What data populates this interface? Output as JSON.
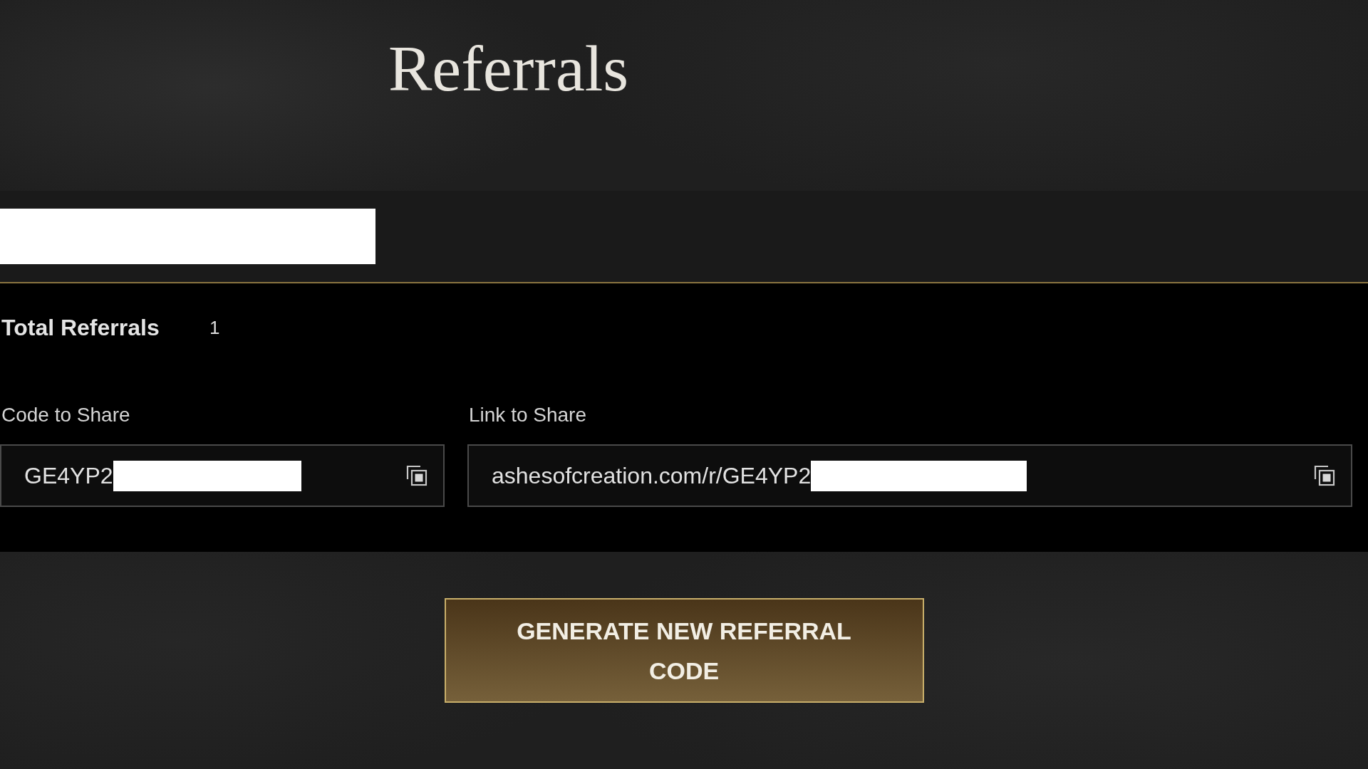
{
  "title": "Referrals",
  "account_bar": {
    "redacted": true
  },
  "stats": {
    "label": "Total Referrals",
    "value": "1"
  },
  "share_fields": [
    {
      "kind": "code",
      "label": "Code to Share",
      "value": "GE4YP2",
      "redacted": true
    },
    {
      "kind": "link",
      "label": "Link to Share",
      "value": "ashesofcreation.com/r/GE4YP2",
      "redacted": true
    }
  ],
  "generate_button": {
    "label": "GENERATE NEW REFERRAL CODE"
  }
}
